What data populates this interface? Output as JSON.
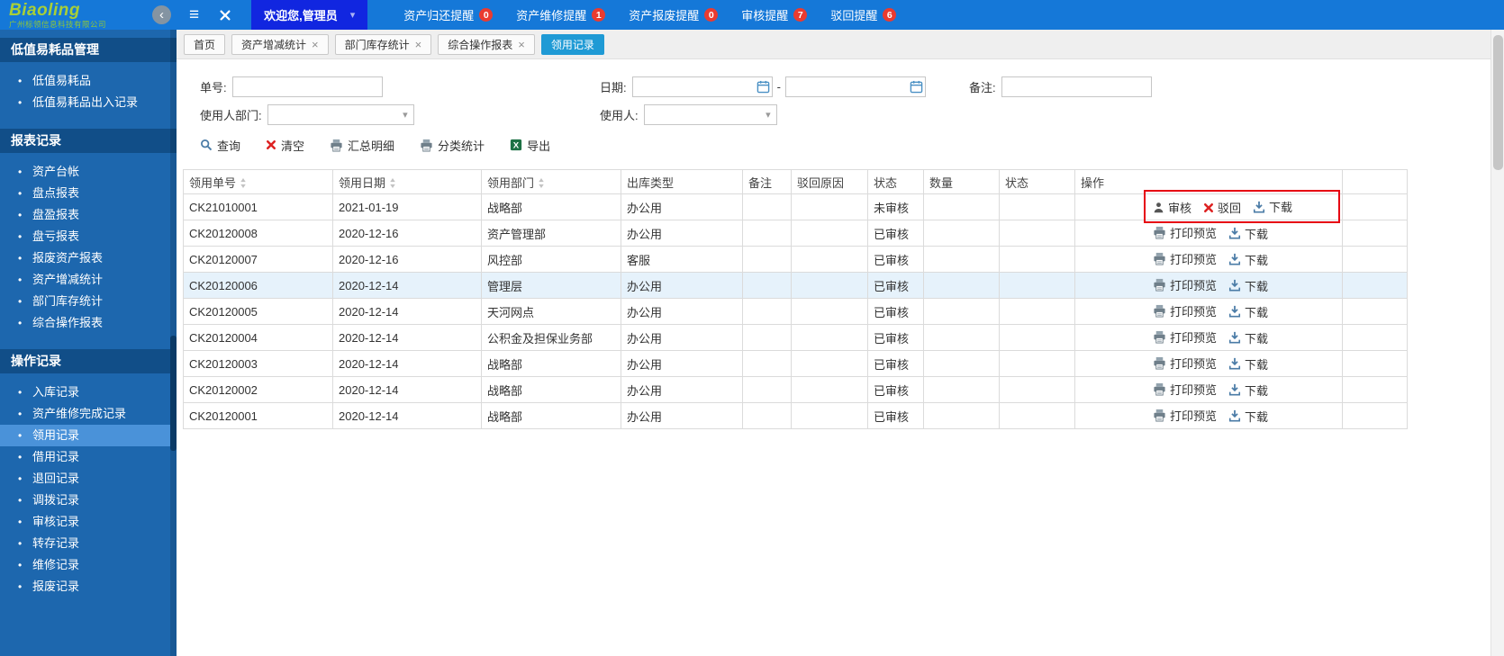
{
  "colors": {
    "topbar": "#1578d8",
    "welcome_button": "#1126e0",
    "sidebar": "#1d67ae",
    "sidebar_section": "#114e88",
    "sidebar_selected": "#4a92d9",
    "active_tab": "#1f9ad5",
    "badge": "#ea3b30",
    "annotation": "#e60012",
    "selected_row": "#e6f2fb"
  },
  "topbar": {
    "logo": {
      "title": "Biaoling",
      "subtitle": "广州标领信息科技有限公司"
    },
    "welcome": {
      "label": "欢迎您,管理员"
    },
    "menu": [
      {
        "label": "资产归还提醒",
        "badge": "0"
      },
      {
        "label": "资产维修提醒",
        "badge": "1"
      },
      {
        "label": "资产报废提醒",
        "badge": "0"
      },
      {
        "label": "审核提醒",
        "badge": "7"
      },
      {
        "label": "驳回提醒",
        "badge": "6"
      }
    ]
  },
  "sidebar": {
    "sections": [
      {
        "title": "低值易耗品管理",
        "items": [
          {
            "label": "低值易耗品"
          },
          {
            "label": "低值易耗品出入记录"
          }
        ]
      },
      {
        "title": "报表记录",
        "items": [
          {
            "label": "资产台帐"
          },
          {
            "label": "盘点报表"
          },
          {
            "label": "盘盈报表"
          },
          {
            "label": "盘亏报表"
          },
          {
            "label": "报废资产报表"
          },
          {
            "label": "资产增减统计"
          },
          {
            "label": "部门库存统计"
          },
          {
            "label": "综合操作报表"
          }
        ]
      },
      {
        "title": "操作记录",
        "items": [
          {
            "label": "入库记录"
          },
          {
            "label": "资产维修完成记录"
          },
          {
            "label": "领用记录",
            "selected": true
          },
          {
            "label": "借用记录"
          },
          {
            "label": "退回记录"
          },
          {
            "label": "调拨记录"
          },
          {
            "label": "审核记录"
          },
          {
            "label": "转存记录"
          },
          {
            "label": "维修记录"
          },
          {
            "label": "报废记录"
          }
        ]
      }
    ]
  },
  "tabs": [
    {
      "label": "首页",
      "closable": false,
      "active": false
    },
    {
      "label": "资产增减统计",
      "closable": true,
      "active": false
    },
    {
      "label": "部门库存统计",
      "closable": true,
      "active": false
    },
    {
      "label": "综合操作报表",
      "closable": true,
      "active": false
    },
    {
      "label": "领用记录",
      "closable": false,
      "active": true
    }
  ],
  "filters": {
    "order_no": {
      "label": "单号:",
      "value": ""
    },
    "date": {
      "label": "日期:",
      "from": "",
      "to": "",
      "separator": "-"
    },
    "remark": {
      "label": "备注:",
      "value": ""
    },
    "user_dept": {
      "label": "使用人部门:",
      "value": ""
    },
    "user": {
      "label": "使用人:",
      "value": ""
    }
  },
  "toolbar": [
    {
      "label": "查询",
      "icon": "magnifier"
    },
    {
      "label": "清空",
      "icon": "red-x"
    },
    {
      "label": "汇总明细",
      "icon": "printer"
    },
    {
      "label": "分类统计",
      "icon": "printer"
    },
    {
      "label": "导出",
      "icon": "excel"
    }
  ],
  "table": {
    "columns": [
      {
        "label": "领用单号",
        "sortable": true
      },
      {
        "label": "领用日期",
        "sortable": true
      },
      {
        "label": "领用部门",
        "sortable": true
      },
      {
        "label": "出库类型",
        "sortable": false
      },
      {
        "label": "备注",
        "sortable": false
      },
      {
        "label": "驳回原因",
        "sortable": false
      },
      {
        "label": "状态",
        "sortable": false
      },
      {
        "label": "数量",
        "sortable": false
      },
      {
        "label": "状态",
        "sortable": false
      },
      {
        "label": "操作",
        "sortable": false
      },
      {
        "label": "",
        "sortable": false
      }
    ],
    "action_labels": {
      "print": "打印预览",
      "audit": "审核",
      "reject": "驳回",
      "download": "下载"
    },
    "action_icons": {
      "print": "printer",
      "audit": "person",
      "reject": "red-x",
      "download": "download"
    },
    "rows": [
      {
        "order_no": "CK21010001",
        "date": "2021-01-19",
        "dept": "战略部",
        "out_type": "办公用",
        "remark": "",
        "reject_reason": "",
        "status": "未审核",
        "qty": "",
        "status2": "",
        "actions": [
          "audit",
          "reject",
          "download"
        ],
        "annotated": true,
        "selected": false
      },
      {
        "order_no": "CK20120008",
        "date": "2020-12-16",
        "dept": "资产管理部",
        "out_type": "办公用",
        "remark": "",
        "reject_reason": "",
        "status": "已审核",
        "qty": "",
        "status2": "",
        "actions": [
          "print",
          "download"
        ],
        "annotated": false,
        "selected": false
      },
      {
        "order_no": "CK20120007",
        "date": "2020-12-16",
        "dept": "风控部",
        "out_type": "客服",
        "remark": "",
        "reject_reason": "",
        "status": "已审核",
        "qty": "",
        "status2": "",
        "actions": [
          "print",
          "download"
        ],
        "annotated": false,
        "selected": false
      },
      {
        "order_no": "CK20120006",
        "date": "2020-12-14",
        "dept": "管理层",
        "out_type": "办公用",
        "remark": "",
        "reject_reason": "",
        "status": "已审核",
        "qty": "",
        "status2": "",
        "actions": [
          "print",
          "download"
        ],
        "annotated": false,
        "selected": true
      },
      {
        "order_no": "CK20120005",
        "date": "2020-12-14",
        "dept": "天河网点",
        "out_type": "办公用",
        "remark": "",
        "reject_reason": "",
        "status": "已审核",
        "qty": "",
        "status2": "",
        "actions": [
          "print",
          "download"
        ],
        "annotated": false,
        "selected": false
      },
      {
        "order_no": "CK20120004",
        "date": "2020-12-14",
        "dept": "公积金及担保业务部",
        "out_type": "办公用",
        "remark": "",
        "reject_reason": "",
        "status": "已审核",
        "qty": "",
        "status2": "",
        "actions": [
          "print",
          "download"
        ],
        "annotated": false,
        "selected": false
      },
      {
        "order_no": "CK20120003",
        "date": "2020-12-14",
        "dept": "战略部",
        "out_type": "办公用",
        "remark": "",
        "reject_reason": "",
        "status": "已审核",
        "qty": "",
        "status2": "",
        "actions": [
          "print",
          "download"
        ],
        "annotated": false,
        "selected": false
      },
      {
        "order_no": "CK20120002",
        "date": "2020-12-14",
        "dept": "战略部",
        "out_type": "办公用",
        "remark": "",
        "reject_reason": "",
        "status": "已审核",
        "qty": "",
        "status2": "",
        "actions": [
          "print",
          "download"
        ],
        "annotated": false,
        "selected": false
      },
      {
        "order_no": "CK20120001",
        "date": "2020-12-14",
        "dept": "战略部",
        "out_type": "办公用",
        "remark": "",
        "reject_reason": "",
        "status": "已审核",
        "qty": "",
        "status2": "",
        "actions": [
          "print",
          "download"
        ],
        "annotated": false,
        "selected": false
      }
    ]
  }
}
